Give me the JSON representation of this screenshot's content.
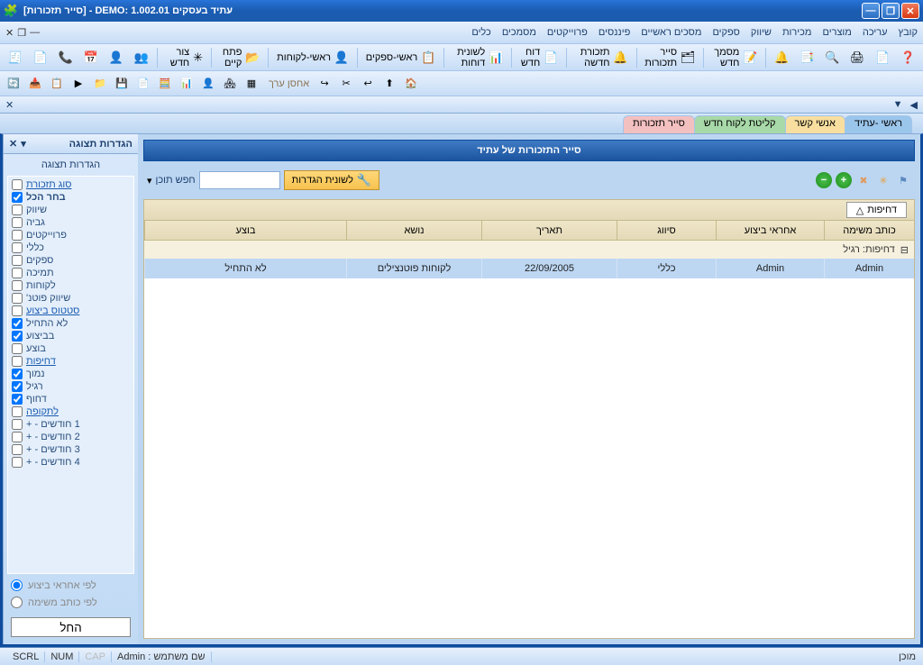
{
  "window": {
    "title": "עתיד בעסקים DEMO: 1.002.01 - [סייר תזכורות]"
  },
  "menubar": {
    "items": [
      "קובץ",
      "עריכה",
      "מוצרים",
      "מכירות",
      "שיווק",
      "ספקים",
      "מסכים ראשיים",
      "פיננסים",
      "פרוייקטים",
      "מסמכים",
      "כלים"
    ]
  },
  "toolbar1": {
    "items": [
      {
        "label": "צור חדש",
        "icon": "✳"
      },
      {
        "label": "פתח קיים",
        "icon": "📂"
      },
      {
        "label": "ראשי-לקוחות",
        "icon": "👤"
      },
      {
        "label": "ראשי-ספקים",
        "icon": "📋"
      },
      {
        "label": "לשונית דוחות",
        "icon": "📊"
      },
      {
        "label": "דוח חדש",
        "icon": "📄"
      },
      {
        "label": "תזכורת חדשה",
        "icon": "🔔"
      },
      {
        "label": "סייר תזכורות",
        "icon": "🗂"
      },
      {
        "label": "מסמך חדש",
        "icon": "📝"
      }
    ]
  },
  "toolbar2": {
    "storage_label": "אחסן ערך"
  },
  "tabs": [
    {
      "label": "ראשי -עתיד",
      "cls": "t1"
    },
    {
      "label": "אנשי קשר",
      "cls": "t2"
    },
    {
      "label": "קליטת לקוח חדש",
      "cls": "t3"
    },
    {
      "label": "סייר תזכורות",
      "cls": "t4"
    }
  ],
  "panel_title": "סייר התזכורות של עתיד",
  "search": {
    "settings_btn": "לשונית הגדרות",
    "search_label": "חפש תוכן"
  },
  "priority_btn": "דחיפות",
  "columns": [
    "כותב משימה",
    "אחראי ביצוע",
    "סיווג",
    "תאריך",
    "נושא",
    "בוצע"
  ],
  "group_label": "דחיפות: רגיל",
  "rows": [
    {
      "writer": "Admin",
      "owner": "Admin",
      "class": "כללי",
      "date": "22/09/2005",
      "subject": "לקוחות פוטנצילים",
      "done": "לא התחיל"
    }
  ],
  "sidebar": {
    "header": "הגדרות תצוגה",
    "title": "הגדרות תצוגה",
    "items": [
      {
        "label": "סוג תזכורת",
        "group": true,
        "checked": false
      },
      {
        "label": "בחר הכל",
        "checked": true,
        "bold": true
      },
      {
        "label": "שיווק",
        "checked": false
      },
      {
        "label": "גביה",
        "checked": false
      },
      {
        "label": "פרוייקטים",
        "checked": false
      },
      {
        "label": "כללי",
        "checked": false
      },
      {
        "label": "ספקים",
        "checked": false
      },
      {
        "label": "תמיכה",
        "checked": false
      },
      {
        "label": "לקוחות",
        "checked": false
      },
      {
        "label": "שיווק פוטנ'",
        "checked": false
      },
      {
        "label": "סטטוס ביצוע",
        "group": true,
        "checked": false
      },
      {
        "label": "לא התחיל",
        "checked": true
      },
      {
        "label": "בביצוע",
        "checked": true
      },
      {
        "label": "בוצע",
        "checked": false
      },
      {
        "label": "דחיפות",
        "group": true,
        "checked": false
      },
      {
        "label": "נמוך",
        "checked": true
      },
      {
        "label": "רגיל",
        "checked": true
      },
      {
        "label": "דחוף",
        "checked": true
      },
      {
        "label": "לתקופה",
        "group": true,
        "checked": false
      },
      {
        "label": "1 חודשים - +",
        "checked": false
      },
      {
        "label": "2 חודשים - +",
        "checked": false
      },
      {
        "label": "3 חודשים - +",
        "checked": false
      },
      {
        "label": "4 חודשים - +",
        "checked": false
      }
    ],
    "radio1": "לפי אחראי ביצוע",
    "radio2": "לפי כותב משימה",
    "apply": "החל"
  },
  "statusbar": {
    "ready": "מוכן",
    "user_label": "שם משתמש : Admin",
    "cap": "CAP",
    "num": "NUM",
    "scrl": "SCRL"
  }
}
